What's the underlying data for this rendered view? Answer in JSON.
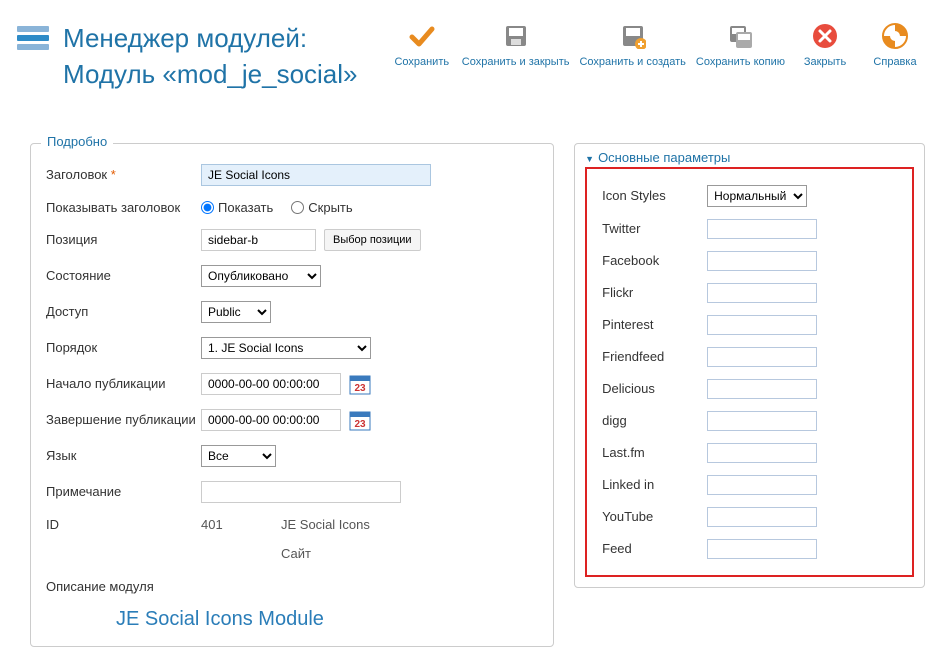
{
  "header": {
    "title_line1": "Менеджер модулей:",
    "title_line2": "Модуль «mod_je_social»"
  },
  "toolbar": {
    "save": "Сохранить",
    "save_close": "Сохранить и закрыть",
    "save_new": "Сохранить и создать",
    "save_copy": "Сохранить копию",
    "close": "Закрыть",
    "help": "Справка"
  },
  "panels": {
    "details_title": "Подробно",
    "params_title": "Основные параметры"
  },
  "fields": {
    "title_label": "Заголовок",
    "title_value": "JE Social Icons",
    "show_title_label": "Показывать заголовок",
    "show_opt": "Показать",
    "hide_opt": "Скрыть",
    "position_label": "Позиция",
    "position_value": "sidebar-b",
    "position_btn": "Выбор позиции",
    "state_label": "Состояние",
    "state_value": "Опубликовано",
    "access_label": "Доступ",
    "access_value": "Public",
    "order_label": "Порядок",
    "order_value": "1. JE Social Icons",
    "start_pub_label": "Начало публикации",
    "start_pub_value": "0000-00-00 00:00:00",
    "end_pub_label": "Завершение публикации",
    "end_pub_value": "0000-00-00 00:00:00",
    "lang_label": "Язык",
    "lang_value": "Все",
    "note_label": "Примечание",
    "note_value": "",
    "id_label": "ID",
    "id_value": "401",
    "id_name": "JE Social Icons",
    "site_label": "Сайт",
    "module_desc_label": "Описание модуля",
    "module_desc_title": "JE Social Icons Module"
  },
  "params": {
    "icon_styles_label": "Icon Styles",
    "icon_styles_value": "Нормальный",
    "twitter": "Twitter",
    "facebook": "Facebook",
    "flickr": "Flickr",
    "pinterest": "Pinterest",
    "friendfeed": "Friendfeed",
    "delicious": "Delicious",
    "digg": "digg",
    "lastfm": "Last.fm",
    "linkedin": "Linked in",
    "youtube": "YouTube",
    "feed": "Feed"
  }
}
